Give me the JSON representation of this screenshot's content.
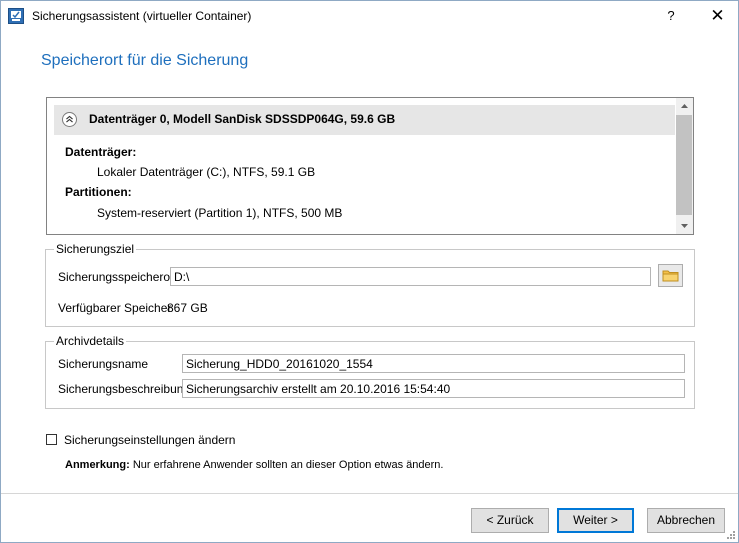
{
  "window": {
    "title": "Sicherungsassistent (virtueller Container)",
    "help_label": "?",
    "close_label": "✕"
  },
  "heading": "Speicherort für die Sicherung",
  "disk": {
    "title": "Datenträger 0, Modell SanDisk SDSSDP064G, 59.6 GB",
    "drives_label": "Datenträger:",
    "drive_item": "Lokaler Datenträger (C:), NTFS, 59.1 GB",
    "partitions_label": "Partitionen:",
    "partition_item": "System-reserviert (Partition 1), NTFS, 500 MB"
  },
  "target": {
    "legend": "Sicherungsziel",
    "location_label": "Sicherungsspeicherort",
    "location_value": "D:\\",
    "free_label": "Verfügbarer Speicher",
    "free_value": "867 GB"
  },
  "archive": {
    "legend": "Archivdetails",
    "name_label": "Sicherungsname",
    "name_value": "Sicherung_HDD0_20161020_1554",
    "desc_label": "Sicherungsbeschreibung",
    "desc_value": "Sicherungsarchiv erstellt am 20.10.2016 15:54:40"
  },
  "options": {
    "change_settings_label": "Sicherungseinstellungen ändern",
    "change_settings_checked": false,
    "note_bold": "Anmerkung:",
    "note_text": " Nur erfahrene Anwender sollten an dieser Option etwas ändern."
  },
  "buttons": {
    "back": "< Zurück",
    "next": "Weiter >",
    "cancel": "Abbrechen"
  },
  "colors": {
    "heading": "#1e6fbd",
    "default_button_border": "#0078d7",
    "header_row_bg": "#e6e6e6"
  },
  "icons": {
    "app": "app-icon",
    "collapse": "chevron-up-double-icon",
    "folder": "folder-icon",
    "scroll_up": "arrow-up-icon",
    "scroll_down": "arrow-down-icon"
  }
}
